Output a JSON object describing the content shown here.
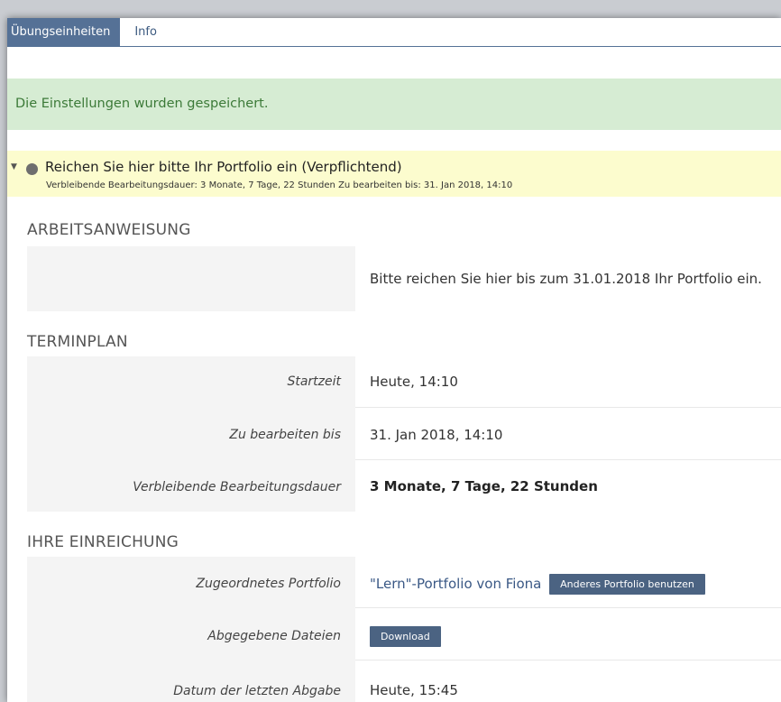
{
  "tabs": [
    {
      "label": "Übungseinheiten"
    },
    {
      "label": "Info"
    }
  ],
  "message": "Die Einstellungen wurden gespeichert.",
  "assignment": {
    "title": "Reichen Sie hier bitte Ihr Portfolio ein (Verpflichtend)",
    "meta": "Verbleibende Bearbeitungsdauer: 3 Monate, 7 Tage, 22 Stunden  Zu bearbeiten bis: 31. Jan 2018, 14:10"
  },
  "arbeitsanweisung": {
    "heading": "ARBEITSANWEISUNG",
    "text": "Bitte reichen Sie hier bis zum 31.01.2018 Ihr Portfolio ein."
  },
  "terminplan": {
    "heading": "TERMINPLAN",
    "rows": [
      {
        "label": "Startzeit",
        "value": "Heute, 14:10"
      },
      {
        "label": "Zu bearbeiten bis",
        "value": "31. Jan 2018, 14:10"
      },
      {
        "label": "Verbleibende Bearbeitungsdauer",
        "value": "3 Monate, 7 Tage, 22 Stunden"
      }
    ]
  },
  "einreichung": {
    "heading": "IHRE EINREICHUNG",
    "portfolio_label": "Zugeordnetes Portfolio",
    "portfolio_link": "\"Lern\"-Portfolio von Fiona",
    "portfolio_button": "Anderes Portfolio benutzen",
    "files_label": "Abgegebene Dateien",
    "download_button": "Download",
    "date_label": "Datum der letzten Abgabe",
    "date_value": "Heute, 15:45"
  },
  "colors": {
    "tab_active": "#557196",
    "success_bg": "#d6ecd3",
    "success_text": "#3c7a38",
    "header_bg": "#fcfcce",
    "button": "#4b6382"
  }
}
